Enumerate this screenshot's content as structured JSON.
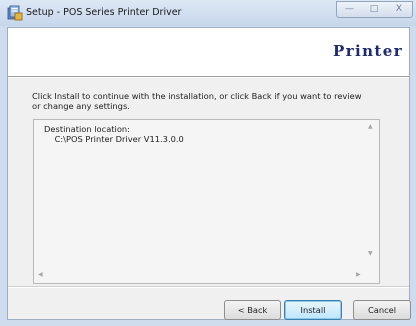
{
  "window": {
    "title": "Setup - POS Series Printer Driver",
    "minimize_symbol": "—",
    "maximize_symbol": "□",
    "close_symbol": "X"
  },
  "header": {
    "logo_text": "Printer"
  },
  "body": {
    "instruction": "Click Install to continue with the installation, or click Back if you want to review or change any settings."
  },
  "memo": {
    "destination_label": "Destination location:",
    "destination_path": "C:\\POS Printer Driver V11.3.0.0",
    "scroll_up": "▲",
    "scroll_down": "▼",
    "scroll_left": "◀",
    "scroll_right": "▶"
  },
  "buttons": {
    "back": "< Back",
    "install": "Install",
    "cancel": "Cancel"
  },
  "colors": {
    "frame": "#cfdced",
    "logo": "#1f2a6e",
    "default_button_border": "#3c7fb1"
  }
}
